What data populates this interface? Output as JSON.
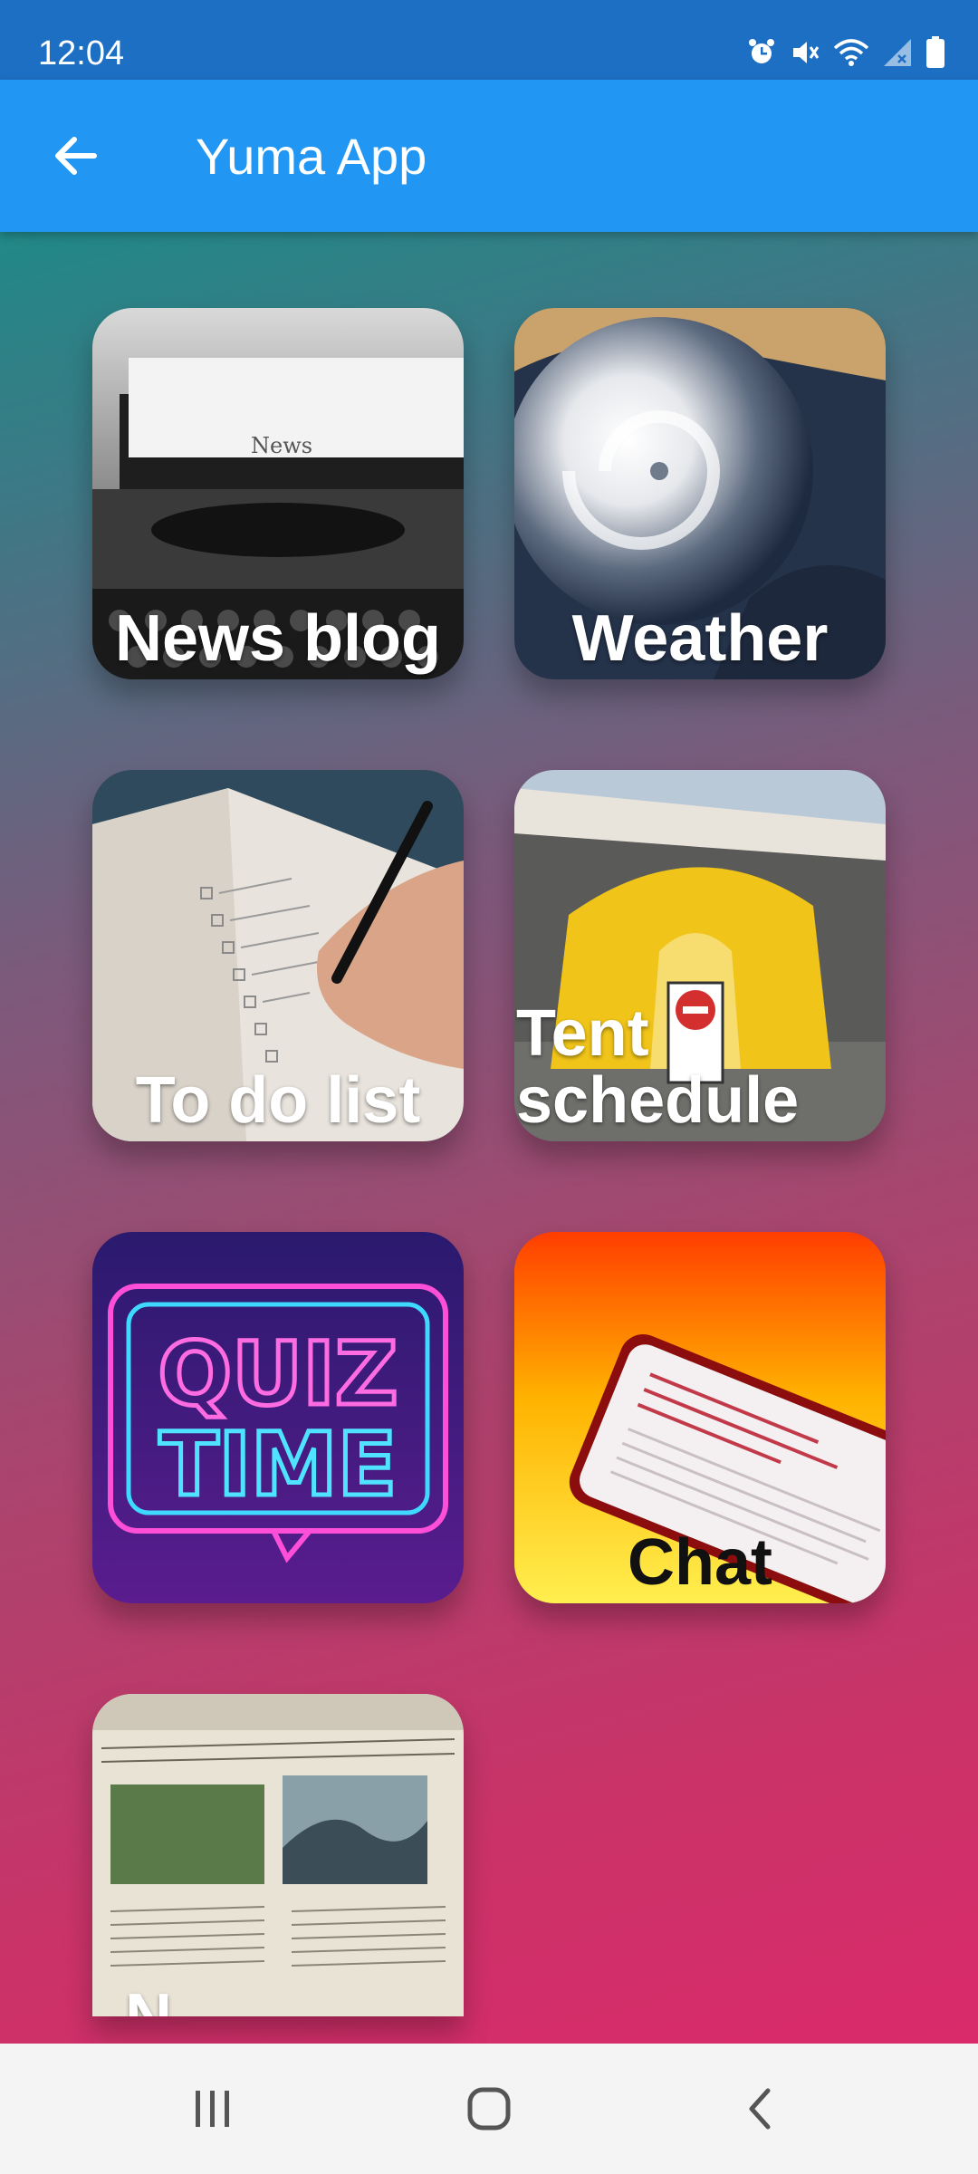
{
  "status_bar": {
    "time": "12:04",
    "icons": [
      "alarm-icon",
      "mute-icon",
      "wifi-icon",
      "signal-icon",
      "battery-icon"
    ]
  },
  "app_bar": {
    "back_icon": "arrow-left-icon",
    "title": "Yuma App",
    "color": "#2196f3"
  },
  "tiles": [
    {
      "label": "News blog",
      "image": "typewriter-news-photo"
    },
    {
      "label": "Weather",
      "image": "hurricane-satellite-photo"
    },
    {
      "label": "To do list",
      "image": "notebook-checklist-photo"
    },
    {
      "label": "Tent schedule",
      "label_lines": [
        "Tent",
        "schedule"
      ],
      "image": "yellow-tent-photo"
    },
    {
      "label": "",
      "image": "quiz-time-neon-sign"
    },
    {
      "label": "Chat",
      "image": "phone-on-yellow-photo"
    },
    {
      "label": "N",
      "image": "newspaper-photo"
    }
  ],
  "quiz_sign": {
    "line1": "QUIZ",
    "line2": "TIME"
  },
  "nav_bar": {
    "icons": [
      "recent-apps-icon",
      "home-icon",
      "back-icon"
    ]
  }
}
